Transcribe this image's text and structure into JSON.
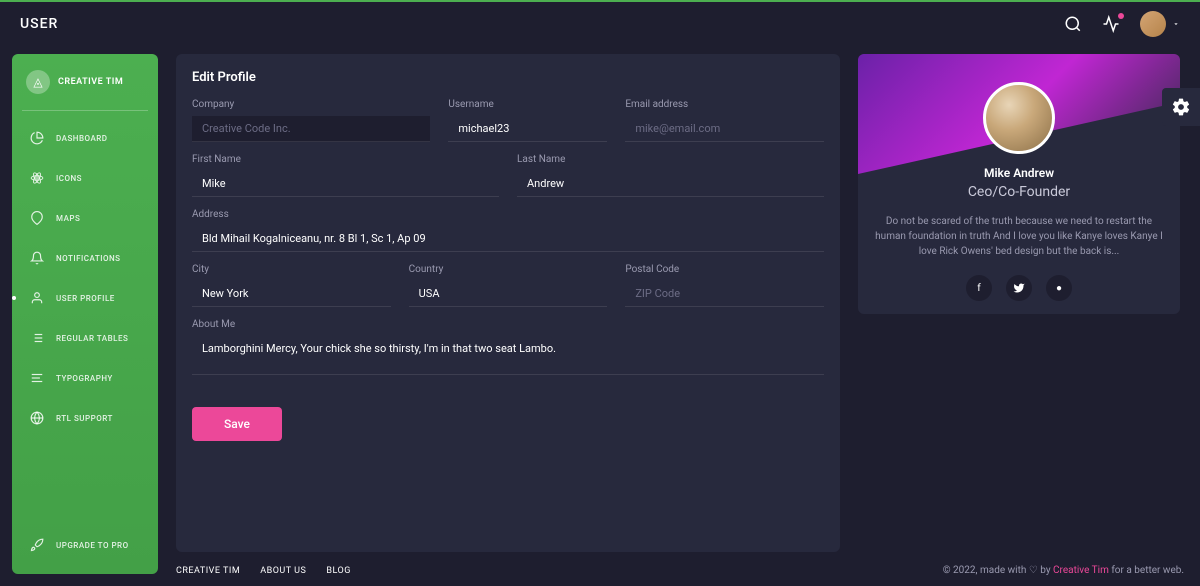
{
  "topbar": {
    "title": "USER"
  },
  "sidebar": {
    "brand": "CREATIVE TIM",
    "items": [
      {
        "label": "DASHBOARD"
      },
      {
        "label": "ICONS"
      },
      {
        "label": "MAPS"
      },
      {
        "label": "NOTIFICATIONS"
      },
      {
        "label": "USER PROFILE"
      },
      {
        "label": "REGULAR TABLES"
      },
      {
        "label": "TYPOGRAPHY"
      },
      {
        "label": "RTL SUPPORT"
      }
    ],
    "upgrade": "UPGRADE TO PRO"
  },
  "form": {
    "title": "Edit Profile",
    "labels": {
      "company": "Company",
      "username": "Username",
      "email": "Email address",
      "firstname": "First Name",
      "lastname": "Last Name",
      "address": "Address",
      "city": "City",
      "country": "Country",
      "postal": "Postal Code",
      "about": "About Me"
    },
    "values": {
      "username": "michael23",
      "firstname": "Mike",
      "lastname": "Andrew",
      "address": "Bld Mihail Kogalniceanu, nr. 8 Bl 1, Sc 1, Ap 09",
      "city": "New York",
      "country": "USA",
      "about": "Lamborghini Mercy, Your chick she so thirsty, I'm in that two seat Lambo."
    },
    "placeholders": {
      "company": "Creative Code Inc.",
      "email": "mike@email.com",
      "postal": "ZIP Code"
    },
    "save": "Save"
  },
  "profile": {
    "name": "Mike Andrew",
    "role": "Ceo/Co-Founder",
    "bio": "Do not be scared of the truth because we need to restart the human foundation in truth And I love you like Kanye loves Kanye I love Rick Owens' bed design but the back is..."
  },
  "footer": {
    "links": [
      "CREATIVE TIM",
      "ABOUT US",
      "BLOG"
    ],
    "copyright_prefix": "© 2022, made with ♡ by ",
    "brand": "Creative Tim",
    "copyright_suffix": " for a better web."
  }
}
